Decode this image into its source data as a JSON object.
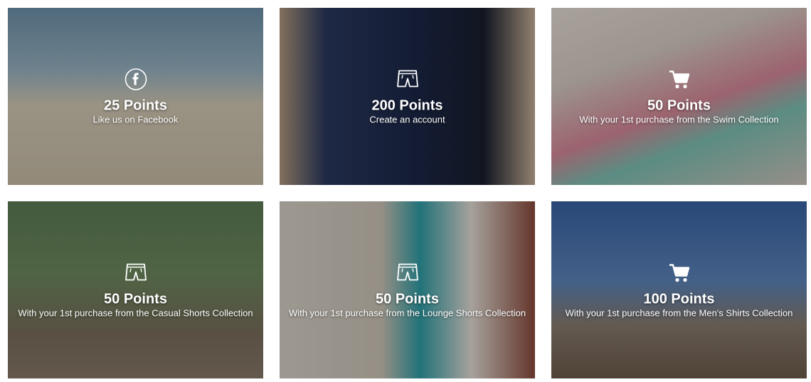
{
  "cards": [
    {
      "points": "25 Points",
      "description": "Like us on Facebook",
      "icon": "facebook-icon"
    },
    {
      "points": "200 Points",
      "description": "Create an account",
      "icon": "shorts-icon"
    },
    {
      "points": "50 Points",
      "description": "With your 1st purchase from the Swim Collection",
      "icon": "cart-icon"
    },
    {
      "points": "50 Points",
      "description": "With your 1st purchase from the Casual Shorts Collection",
      "icon": "shorts-icon"
    },
    {
      "points": "50 Points",
      "description": "With your 1st purchase from the Lounge Shorts Collection",
      "icon": "shorts-icon"
    },
    {
      "points": "100 Points",
      "description": "With your 1st purchase from the Men's Shirts Collection",
      "icon": "cart-icon"
    }
  ]
}
